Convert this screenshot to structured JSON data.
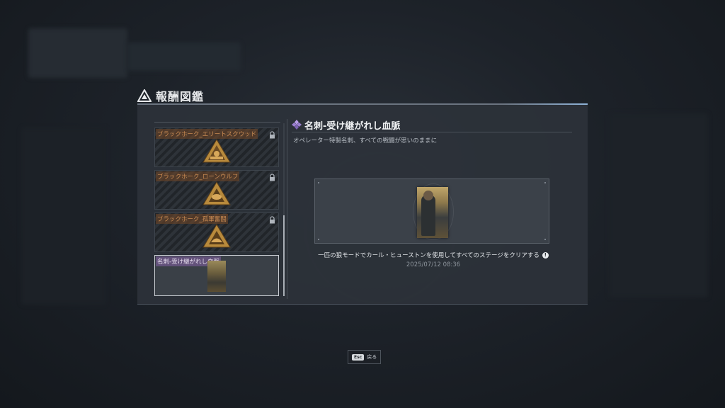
{
  "window": {
    "title": "報酬図鑑"
  },
  "list": {
    "items": [
      {
        "label": "ブラックホーク_エリートスクウッド",
        "locked": true,
        "emblem": "elite-squad-emblem-icon"
      },
      {
        "label": "ブラックホーク_ローンウルフ",
        "locked": true,
        "emblem": "lone-wolf-emblem-icon"
      },
      {
        "label": "ブラックホーク_孤軍奮闘",
        "locked": true,
        "emblem": "lone-battle-emblem-icon"
      },
      {
        "label": "名刺-受け継がれし血脈",
        "locked": false,
        "selected": true,
        "emblem": "name-card-thumbnail"
      }
    ]
  },
  "detail": {
    "title": "名刺-受け継がれし血脈",
    "rarity_icon": "purple-diamond-icon",
    "description": "オペレーター特製名刺、すべての戦闘が思いのままに",
    "condition": "一匹の狼モードでカール・ヒューストンを使用してすべてのステージをクリアする",
    "timestamp": "2025/07/12 08:36"
  },
  "footer": {
    "key": "Esc",
    "label": "戻る"
  },
  "colors": {
    "locked_label": "#c88a52",
    "selected_label": "#9a7ab8",
    "rarity": "#9b7fd0",
    "accent": "#8fb3d8"
  }
}
